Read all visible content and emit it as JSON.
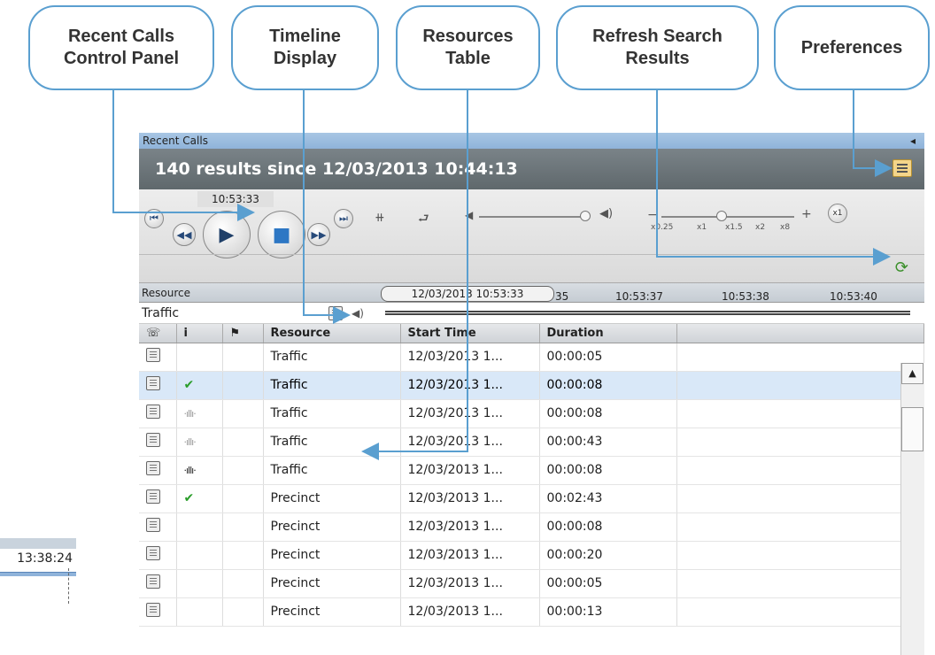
{
  "callouts": [
    {
      "line1": "Recent Calls",
      "line2": "Control Panel"
    },
    {
      "line1": "Timeline",
      "line2": "Display"
    },
    {
      "line1": "Resources",
      "line2": "Table"
    },
    {
      "line1": "Refresh Search",
      "line2": "Results"
    },
    {
      "line1": "Preferences",
      "line2": ""
    }
  ],
  "panel": {
    "title": "Recent Calls",
    "collapse_glyph": "◂",
    "results_text": "140 results since 12/03/2013 10:44:13",
    "current_time": "10:53:33",
    "speed_labels": [
      "x0.25",
      "x1",
      "x1.5",
      "x2",
      "x8"
    ],
    "speed_value": "x1",
    "volume_level": 1.0,
    "speed_position": 0.45
  },
  "timeline": {
    "header_label": "Resource",
    "row_label": "Traffic",
    "current_pill": "12/03/2013 10:53:33",
    "tick_labels": [
      "35",
      "10:53:37",
      "10:53:38",
      "10:53:40"
    ]
  },
  "table": {
    "columns": [
      "",
      "",
      "",
      "Resource",
      "Start Time",
      "Duration"
    ],
    "rows": [
      {
        "status": "",
        "resource": "Traffic",
        "start": "12/03/2013 1...",
        "duration": "00:00:05"
      },
      {
        "status": "check",
        "resource": "Traffic",
        "start": "12/03/2013 1...",
        "duration": "00:00:08"
      },
      {
        "status": "wave",
        "resource": "Traffic",
        "start": "12/03/2013 1...",
        "duration": "00:00:08"
      },
      {
        "status": "wave",
        "resource": "Traffic",
        "start": "12/03/2013 1...",
        "duration": "00:00:43"
      },
      {
        "status": "wave-dark",
        "resource": "Traffic",
        "start": "12/03/2013 1...",
        "duration": "00:00:08"
      },
      {
        "status": "check",
        "resource": "Precinct",
        "start": "12/03/2013 1...",
        "duration": "00:02:43"
      },
      {
        "status": "",
        "resource": "Precinct",
        "start": "12/03/2013 1...",
        "duration": "00:00:08"
      },
      {
        "status": "",
        "resource": "Precinct",
        "start": "12/03/2013 1...",
        "duration": "00:00:20"
      },
      {
        "status": "",
        "resource": "Precinct",
        "start": "12/03/2013 1...",
        "duration": "00:00:05"
      },
      {
        "status": "",
        "resource": "Precinct",
        "start": "12/03/2013 1...",
        "duration": "00:00:13"
      }
    ],
    "selected_row": 1
  },
  "fragment": {
    "time_label": "13:38:24"
  },
  "colors": {
    "callout_border": "#5a9fd0",
    "results_bar": "#6b7479",
    "selected_row": "#d9e8f8",
    "check": "#2a9d2a",
    "refresh": "#3a8f2a"
  }
}
